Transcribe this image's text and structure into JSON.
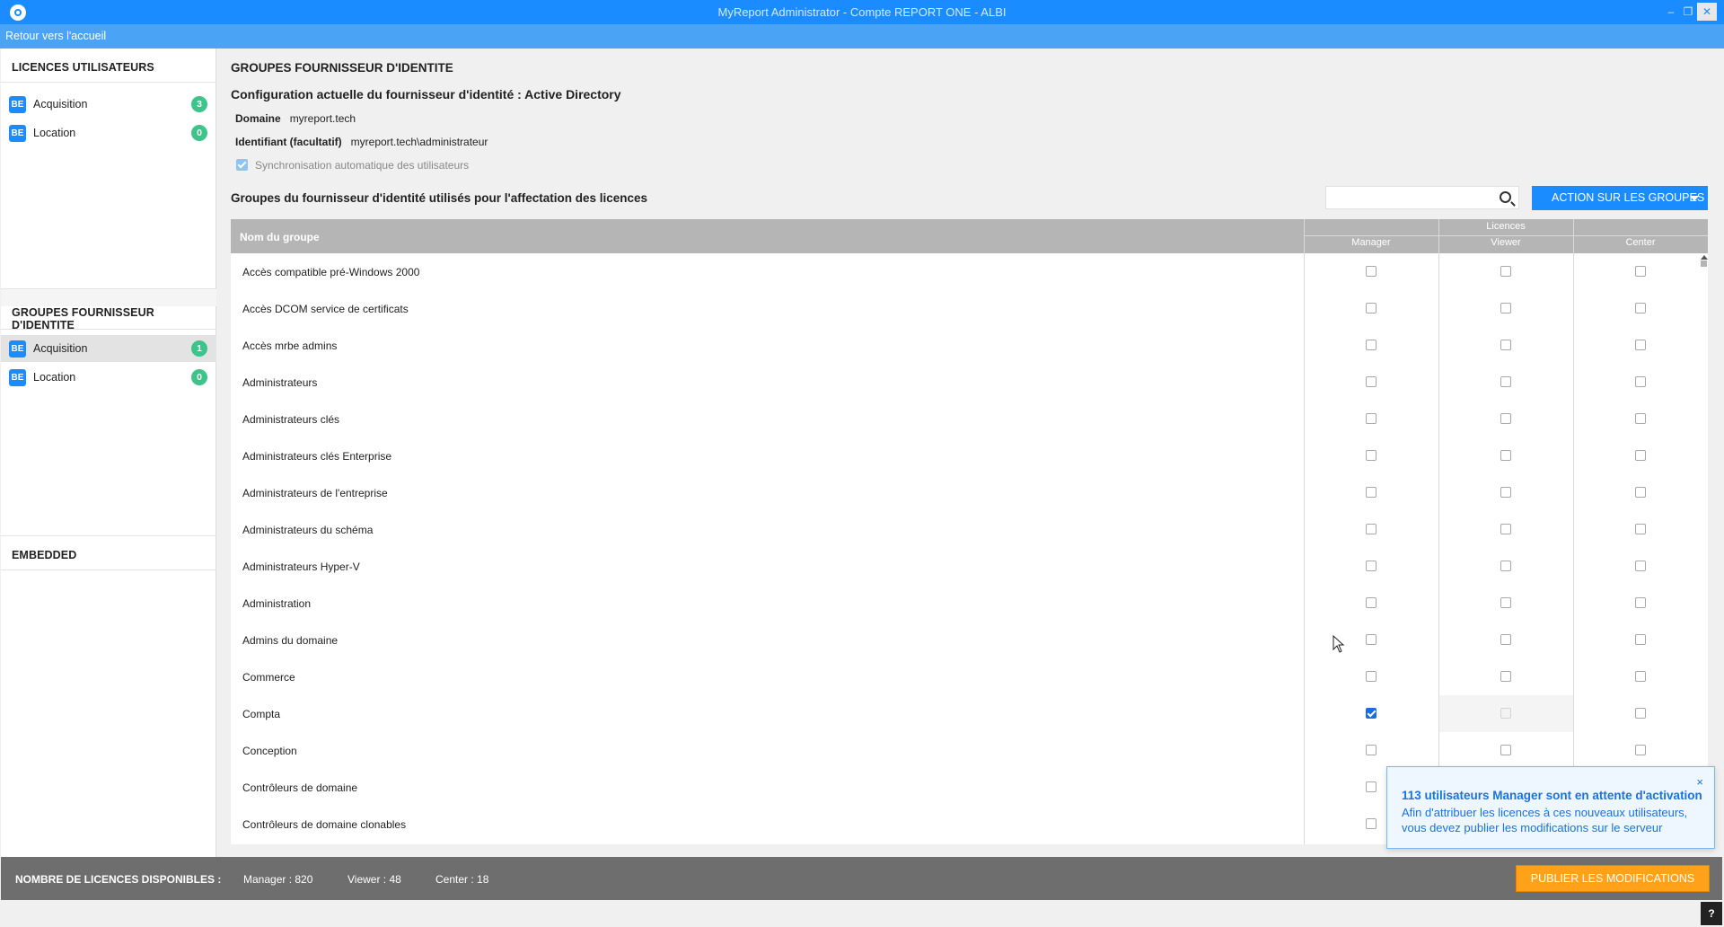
{
  "window": {
    "title": "MyReport Administrator - Compte REPORT ONE - ALBI",
    "min": "–",
    "max": "❐",
    "close": "✕"
  },
  "subbar": {
    "back": "Retour vers l'accueil"
  },
  "sidebar": {
    "section1": {
      "title": "LICENCES UTILISATEURS",
      "items": [
        {
          "badge": "BE",
          "label": "Acquisition",
          "count": "3"
        },
        {
          "badge": "BE",
          "label": "Location",
          "count": "0"
        }
      ]
    },
    "section2": {
      "title": "GROUPES FOURNISSEUR D'IDENTITE",
      "items": [
        {
          "badge": "BE",
          "label": "Acquisition",
          "count": "1"
        },
        {
          "badge": "BE",
          "label": "Location",
          "count": "0"
        }
      ]
    },
    "section3": {
      "title": "EMBEDDED"
    }
  },
  "main": {
    "title": "GROUPES FOURNISSEUR D'IDENTITE",
    "config": "Configuration actuelle du fournisseur d'identité : Active Directory",
    "domain_label": "Domaine",
    "domain_value": "myreport.tech",
    "id_label": "Identifiant (facultatif)",
    "id_value": "myreport.tech\\administrateur",
    "sync_label": "Synchronisation automatique des utilisateurs",
    "groups_title": "Groupes du fournisseur d'identité utilisés pour l'affectation des licences",
    "search_placeholder": "",
    "action_button": "ACTION SUR LES GROUPES"
  },
  "table": {
    "col_name": "Nom du groupe",
    "col_licences": "Licences",
    "col_manager": "Manager",
    "col_viewer": "Viewer",
    "col_center": "Center",
    "rows": [
      {
        "name": "Accès compatible pré-Windows 2000",
        "manager": false,
        "viewer": false,
        "center": false
      },
      {
        "name": "Accès DCOM service de certificats",
        "manager": false,
        "viewer": false,
        "center": false
      },
      {
        "name": "Accès mrbe admins",
        "manager": false,
        "viewer": false,
        "center": false
      },
      {
        "name": "Administrateurs",
        "manager": false,
        "viewer": false,
        "center": false
      },
      {
        "name": "Administrateurs clés",
        "manager": false,
        "viewer": false,
        "center": false
      },
      {
        "name": "Administrateurs clés Enterprise",
        "manager": false,
        "viewer": false,
        "center": false
      },
      {
        "name": "Administrateurs de l'entreprise",
        "manager": false,
        "viewer": false,
        "center": false
      },
      {
        "name": "Administrateurs du schéma",
        "manager": false,
        "viewer": false,
        "center": false
      },
      {
        "name": "Administrateurs Hyper-V",
        "manager": false,
        "viewer": false,
        "center": false
      },
      {
        "name": "Administration",
        "manager": false,
        "viewer": false,
        "center": false
      },
      {
        "name": "Admins du domaine",
        "manager": false,
        "viewer": false,
        "center": false
      },
      {
        "name": "Commerce",
        "manager": false,
        "viewer": false,
        "center": false
      },
      {
        "name": "Compta",
        "manager": true,
        "viewer": "disabled",
        "center": false
      },
      {
        "name": "Conception",
        "manager": false,
        "viewer": false,
        "center": false
      },
      {
        "name": "Contrôleurs de domaine",
        "manager": false,
        "viewer": false,
        "center": false
      },
      {
        "name": "Contrôleurs de domaine clonables",
        "manager": false,
        "viewer": false,
        "center": false
      }
    ]
  },
  "footer": {
    "label": "NOMBRE DE LICENCES DISPONIBLES :",
    "manager": "Manager : 820",
    "viewer": "Viewer : 48",
    "center": "Center : 18",
    "publish": "PUBLIER LES MODIFICATIONS",
    "help": "?"
  },
  "notification": {
    "title": "113 utilisateurs Manager sont en attente d'activation",
    "body": "Afin d'attribuer les licences à ces nouveaux utilisateurs, vous devez publier les modifications sur le serveur",
    "close": "×"
  },
  "colors": {
    "accent": "#1a8cff",
    "badge_green": "#3cc48a",
    "publish": "#ffa21a",
    "footer": "#6e6e6e"
  }
}
